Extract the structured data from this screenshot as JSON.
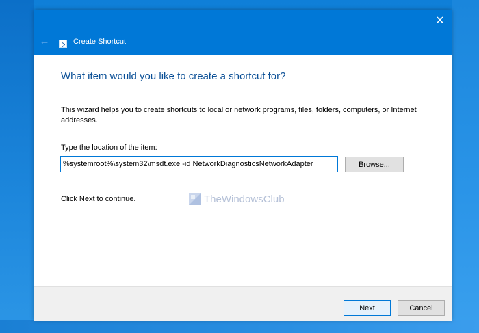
{
  "window": {
    "title": "Create Shortcut",
    "close_glyph": "✕",
    "back_glyph": "←",
    "icons": {
      "back": "back-arrow-icon",
      "app": "shortcut-icon",
      "close": "close-icon"
    }
  },
  "content": {
    "heading": "What item would you like to create a shortcut for?",
    "description": "This wizard helps you to create shortcuts to local or network programs, files, folders, computers, or Internet addresses.",
    "location_label": "Type the location of the item:",
    "location_value": "%systemroot%\\system32\\msdt.exe -id NetworkDiagnosticsNetworkAdapter",
    "browse_label": "Browse...",
    "continue_text": "Click Next to continue."
  },
  "watermark": {
    "text": "TheWindowsClub"
  },
  "footer": {
    "next_label": "Next",
    "cancel_label": "Cancel"
  },
  "colors": {
    "titlebar": "#0078d7",
    "heading": "#0a4f96",
    "desktop": "#1a8be0"
  }
}
